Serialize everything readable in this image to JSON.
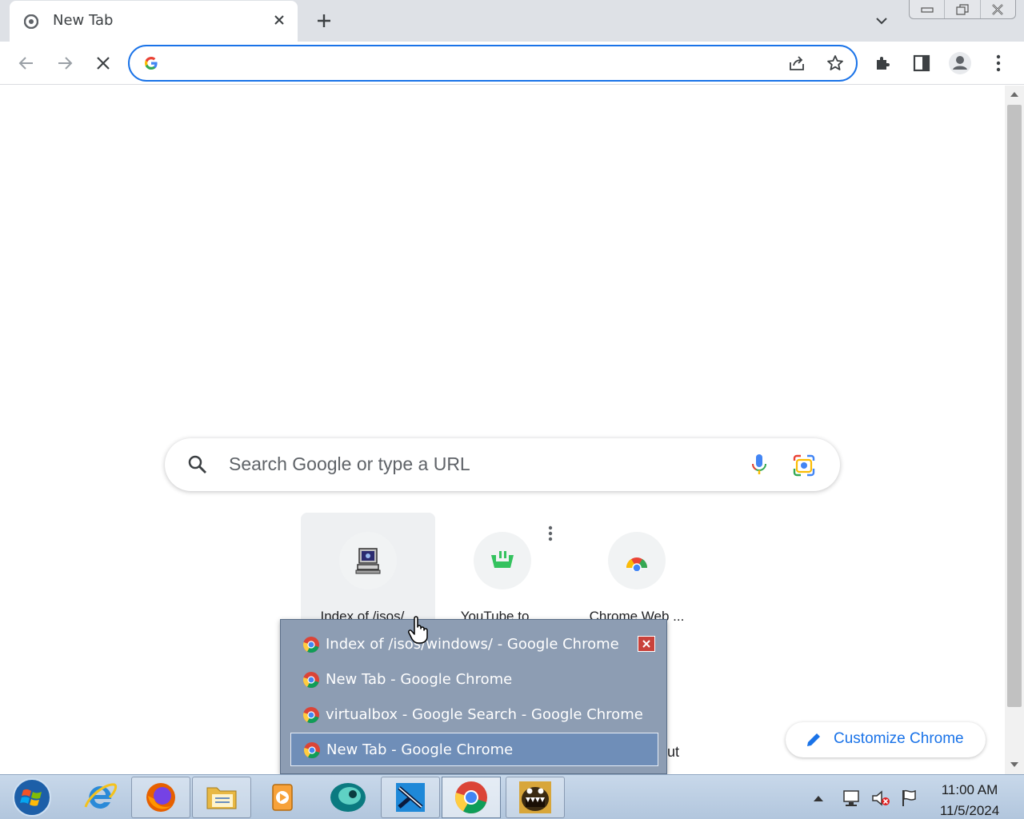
{
  "browser": {
    "tab": {
      "title": "New Tab"
    },
    "omnibox": {
      "value": "",
      "placeholder": ""
    }
  },
  "ntp": {
    "search_placeholder": "Search Google or type a URL",
    "tiles": [
      {
        "label": "Index of /isos/...",
        "icon": "computer-icon"
      },
      {
        "label": "YouTube to ...",
        "icon": "app-icon"
      },
      {
        "label": "Chrome Web ...",
        "icon": "chrome-web-store-icon"
      }
    ],
    "partial_text": "ut",
    "customize_label": "Customize Chrome"
  },
  "taskbar_popup": {
    "items": [
      {
        "label": "Index of /isos/windows/ - Google Chrome"
      },
      {
        "label": "New Tab - Google Chrome"
      },
      {
        "label": "virtualbox - Google Search - Google Chrome"
      },
      {
        "label": "New Tab - Google Chrome"
      }
    ]
  },
  "taskbar": {
    "apps": [
      "internet-explorer",
      "firefox",
      "file-explorer",
      "media-player",
      "app-teal",
      "app-blue",
      "chrome",
      "app-monster"
    ],
    "time": "11:00 AM",
    "date": "11/5/2024"
  },
  "colors": {
    "accent": "#1a73e8",
    "tabstrip": "#dee1e6",
    "popup_bg": "#8d9db3",
    "popup_active": "#6f8eb8",
    "taskbar": "#b9cbe0"
  }
}
